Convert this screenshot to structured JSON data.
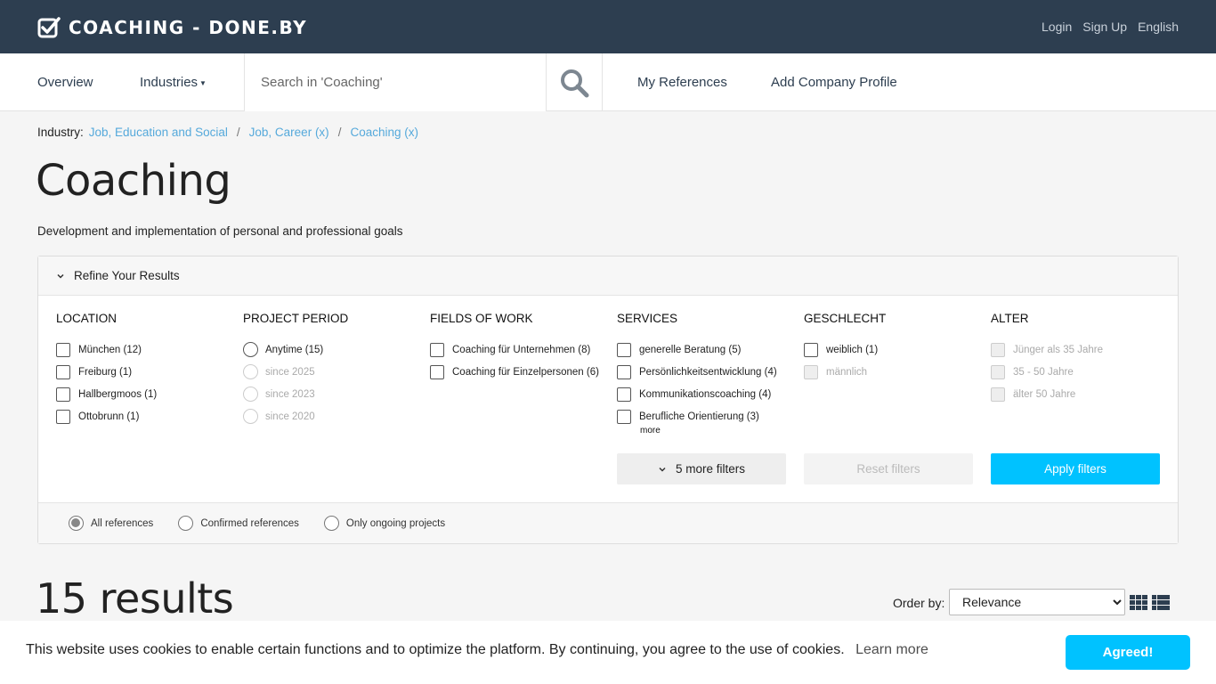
{
  "header": {
    "logo_text": "COACHING - DONE.BY",
    "links": {
      "login": "Login",
      "signup": "Sign Up",
      "language": "English"
    }
  },
  "nav": {
    "overview": "Overview",
    "industries": "Industries",
    "search_placeholder": "Search in 'Coaching'",
    "my_references": "My References",
    "add_company_profile": "Add Company Profile"
  },
  "breadcrumb": {
    "label": "Industry:",
    "items": [
      "Job, Education and Social",
      "Job, Career (x)",
      "Coaching (x)"
    ],
    "separator": "/"
  },
  "page": {
    "title": "Coaching",
    "description": "Development and implementation of personal and professional goals"
  },
  "refine": {
    "title": "Refine Your Results",
    "columns": {
      "location": {
        "heading": "LOCATION",
        "options": [
          "München (12)",
          "Freiburg (1)",
          "Hallbergmoos (1)",
          "Ottobrunn (1)"
        ]
      },
      "project_period": {
        "heading": "PROJECT PERIOD",
        "options": [
          "Anytime (15)",
          "since 2025",
          "since 2023",
          "since 2020"
        ]
      },
      "fields_of_work": {
        "heading": "FIELDS OF WORK",
        "options": [
          "Coaching für Unternehmen (8)",
          "Coaching für Einzelpersonen (6)"
        ]
      },
      "services": {
        "heading": "SERVICES",
        "options": [
          "generelle Beratung (5)",
          "Persönlichkeitsentwicklung (4)",
          "Kommunikationscoaching (4)",
          "Berufliche Orientierung (3)"
        ],
        "more": "more"
      },
      "geschlecht": {
        "heading": "GESCHLECHT",
        "options": [
          "weiblich (1)",
          "männlich"
        ]
      },
      "alter": {
        "heading": "ALTER",
        "options": [
          "Jünger als 35 Jahre",
          "35 - 50 Jahre",
          "älter 50 Jahre"
        ]
      }
    },
    "buttons": {
      "more_filters": "5 more filters",
      "reset": "Reset filters",
      "apply": "Apply filters"
    },
    "footer": {
      "all": "All references",
      "confirmed": "Confirmed references",
      "ongoing": "Only ongoing projects"
    }
  },
  "results": {
    "count_text": "15 results",
    "order_label": "Order by:",
    "order_selected": "Relevance"
  },
  "cookie": {
    "text": "This website uses cookies to enable certain functions and to optimize the platform. By continuing, you agree to the use of cookies.",
    "learn_more": "Learn more",
    "button": "Agreed!"
  },
  "colors": {
    "header_bg": "#2d3e50",
    "accent": "#00c2ff",
    "link": "#55a9db"
  }
}
